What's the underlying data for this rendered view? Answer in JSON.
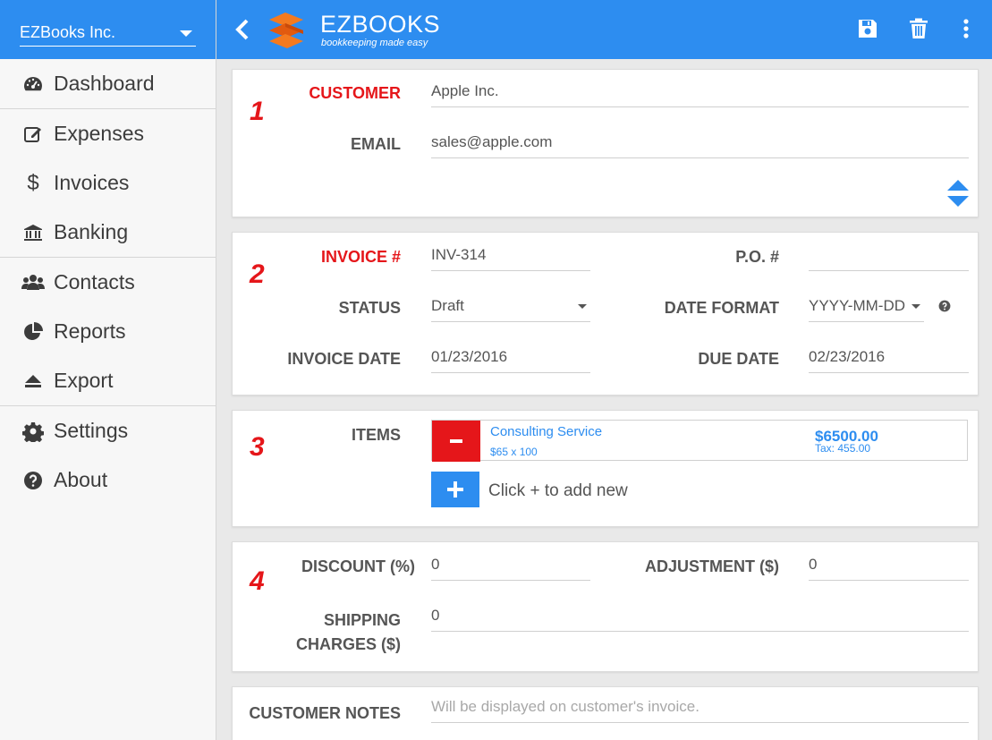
{
  "company": {
    "name": "EZBooks Inc."
  },
  "nav": [
    {
      "label": "Dashboard",
      "icon": "dashboard-icon"
    },
    {
      "label": "Expenses",
      "icon": "edit-icon"
    },
    {
      "label": "Invoices",
      "icon": "dollar-icon"
    },
    {
      "label": "Banking",
      "icon": "bank-icon"
    },
    {
      "label": "Contacts",
      "icon": "users-icon"
    },
    {
      "label": "Reports",
      "icon": "pie-chart-icon"
    },
    {
      "label": "Export",
      "icon": "eject-icon"
    },
    {
      "label": "Settings",
      "icon": "gear-icon"
    },
    {
      "label": "About",
      "icon": "help-circle-icon"
    }
  ],
  "header": {
    "logo_name": "EZBOOKS",
    "logo_tagline": "bookkeeping made easy",
    "colors": {
      "primary": "#2d8df0",
      "accent": "#e5161a",
      "logo_orange": "#f47a1f"
    }
  },
  "sections": {
    "customer": {
      "number": "1",
      "customer_label": "CUSTOMER",
      "customer_value": "Apple Inc.",
      "email_label": "EMAIL",
      "email_value": "sales@apple.com"
    },
    "invoice": {
      "number": "2",
      "invoice_no_label": "INVOICE #",
      "invoice_no_value": "INV-314",
      "po_label": "P.O. #",
      "po_value": "",
      "status_label": "STATUS",
      "status_value": "Draft",
      "date_format_label": "DATE FORMAT",
      "date_format_value": "YYYY-MM-DD",
      "invoice_date_label": "INVOICE DATE",
      "invoice_date_value": "01/23/2016",
      "due_date_label": "DUE DATE",
      "due_date_value": "02/23/2016"
    },
    "items": {
      "number": "3",
      "label": "ITEMS",
      "list": [
        {
          "name": "Consulting Service",
          "qty": "$65 x 100",
          "price": "$6500.00",
          "tax": "Tax: 455.00"
        }
      ],
      "add_hint": "Click + to add new"
    },
    "totals": {
      "number": "4",
      "discount_label": "DISCOUNT (%)",
      "discount_value": "0",
      "adjustment_label": "ADJUSTMENT ($)",
      "adjustment_value": "0",
      "shipping_label_1": "SHIPPING",
      "shipping_label_2": "CHARGES ($)",
      "shipping_value": "0"
    },
    "notes": {
      "label": "CUSTOMER NOTES",
      "placeholder": "Will be displayed on customer's invoice."
    }
  }
}
